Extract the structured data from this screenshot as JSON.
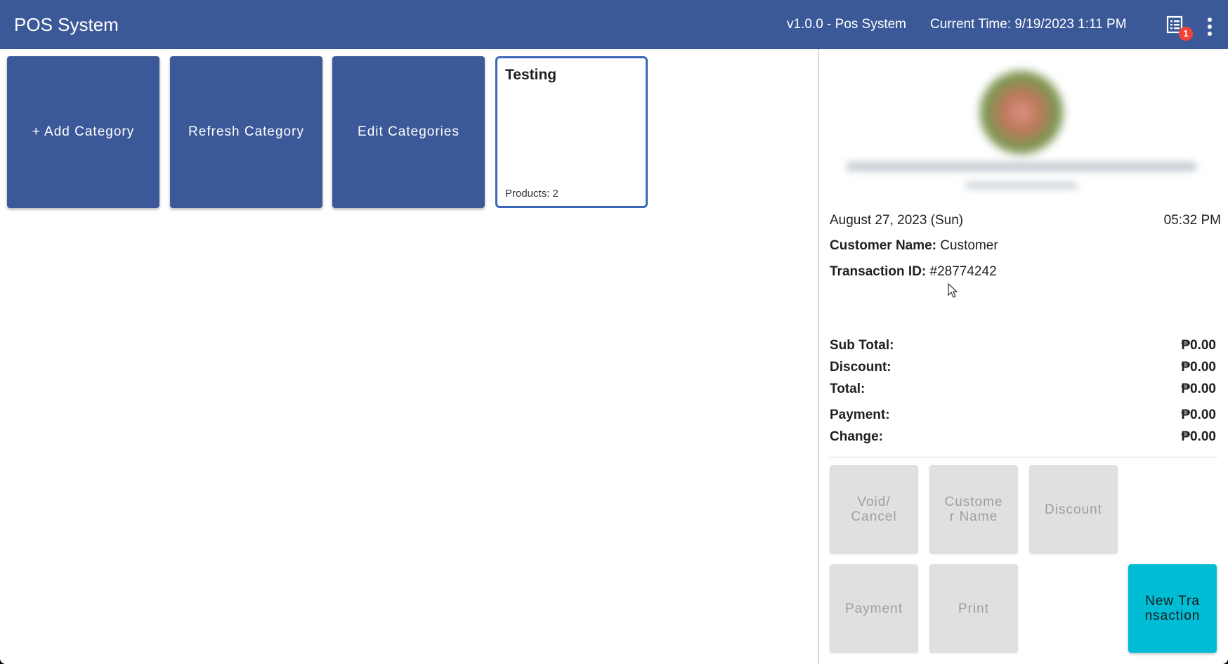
{
  "header": {
    "title": "POS System",
    "version": "v1.0.0 - Pos System",
    "current_time": "Current Time: 9/19/2023 1:11 PM",
    "receipt_icon": "receipt-list-icon",
    "notification_count": "1",
    "more_icon": "more-vert-icon"
  },
  "category_actions": {
    "add": "+ Add Category",
    "refresh": "Refresh Category",
    "edit": "Edit Categories"
  },
  "categories": [
    {
      "name": "Testing",
      "products": "Products: 2"
    }
  ],
  "receipt": {
    "logo": "store-logo",
    "date": "August 27, 2023 (Sun)",
    "time": "05:32 PM",
    "customer_label": "Customer Name:",
    "customer_value": "Customer",
    "transaction_label": "Transaction ID:",
    "transaction_value": "#28774242",
    "summary": [
      {
        "label": "Sub Total:",
        "amount": "₱0.00"
      },
      {
        "label": "Discount:",
        "amount": "₱0.00"
      },
      {
        "label": "Total:",
        "amount": "₱0.00"
      },
      {
        "label": "Payment:",
        "amount": "₱0.00"
      },
      {
        "label": "Change:",
        "amount": "₱0.00"
      }
    ]
  },
  "actions": {
    "void_line1": "Void/",
    "void_line2": "Cancel",
    "customer_line1": "Custome",
    "customer_line2": "r Name",
    "discount": "Discount",
    "payment": "Payment",
    "print": "Print",
    "new_line1": "New Tra",
    "new_line2": "nsaction"
  },
  "colors": {
    "primary": "#3b5998",
    "accent": "#00bcd4",
    "badge": "#f44336",
    "disabled_bg": "#e0e0e0",
    "disabled_text": "#9e9e9e"
  }
}
